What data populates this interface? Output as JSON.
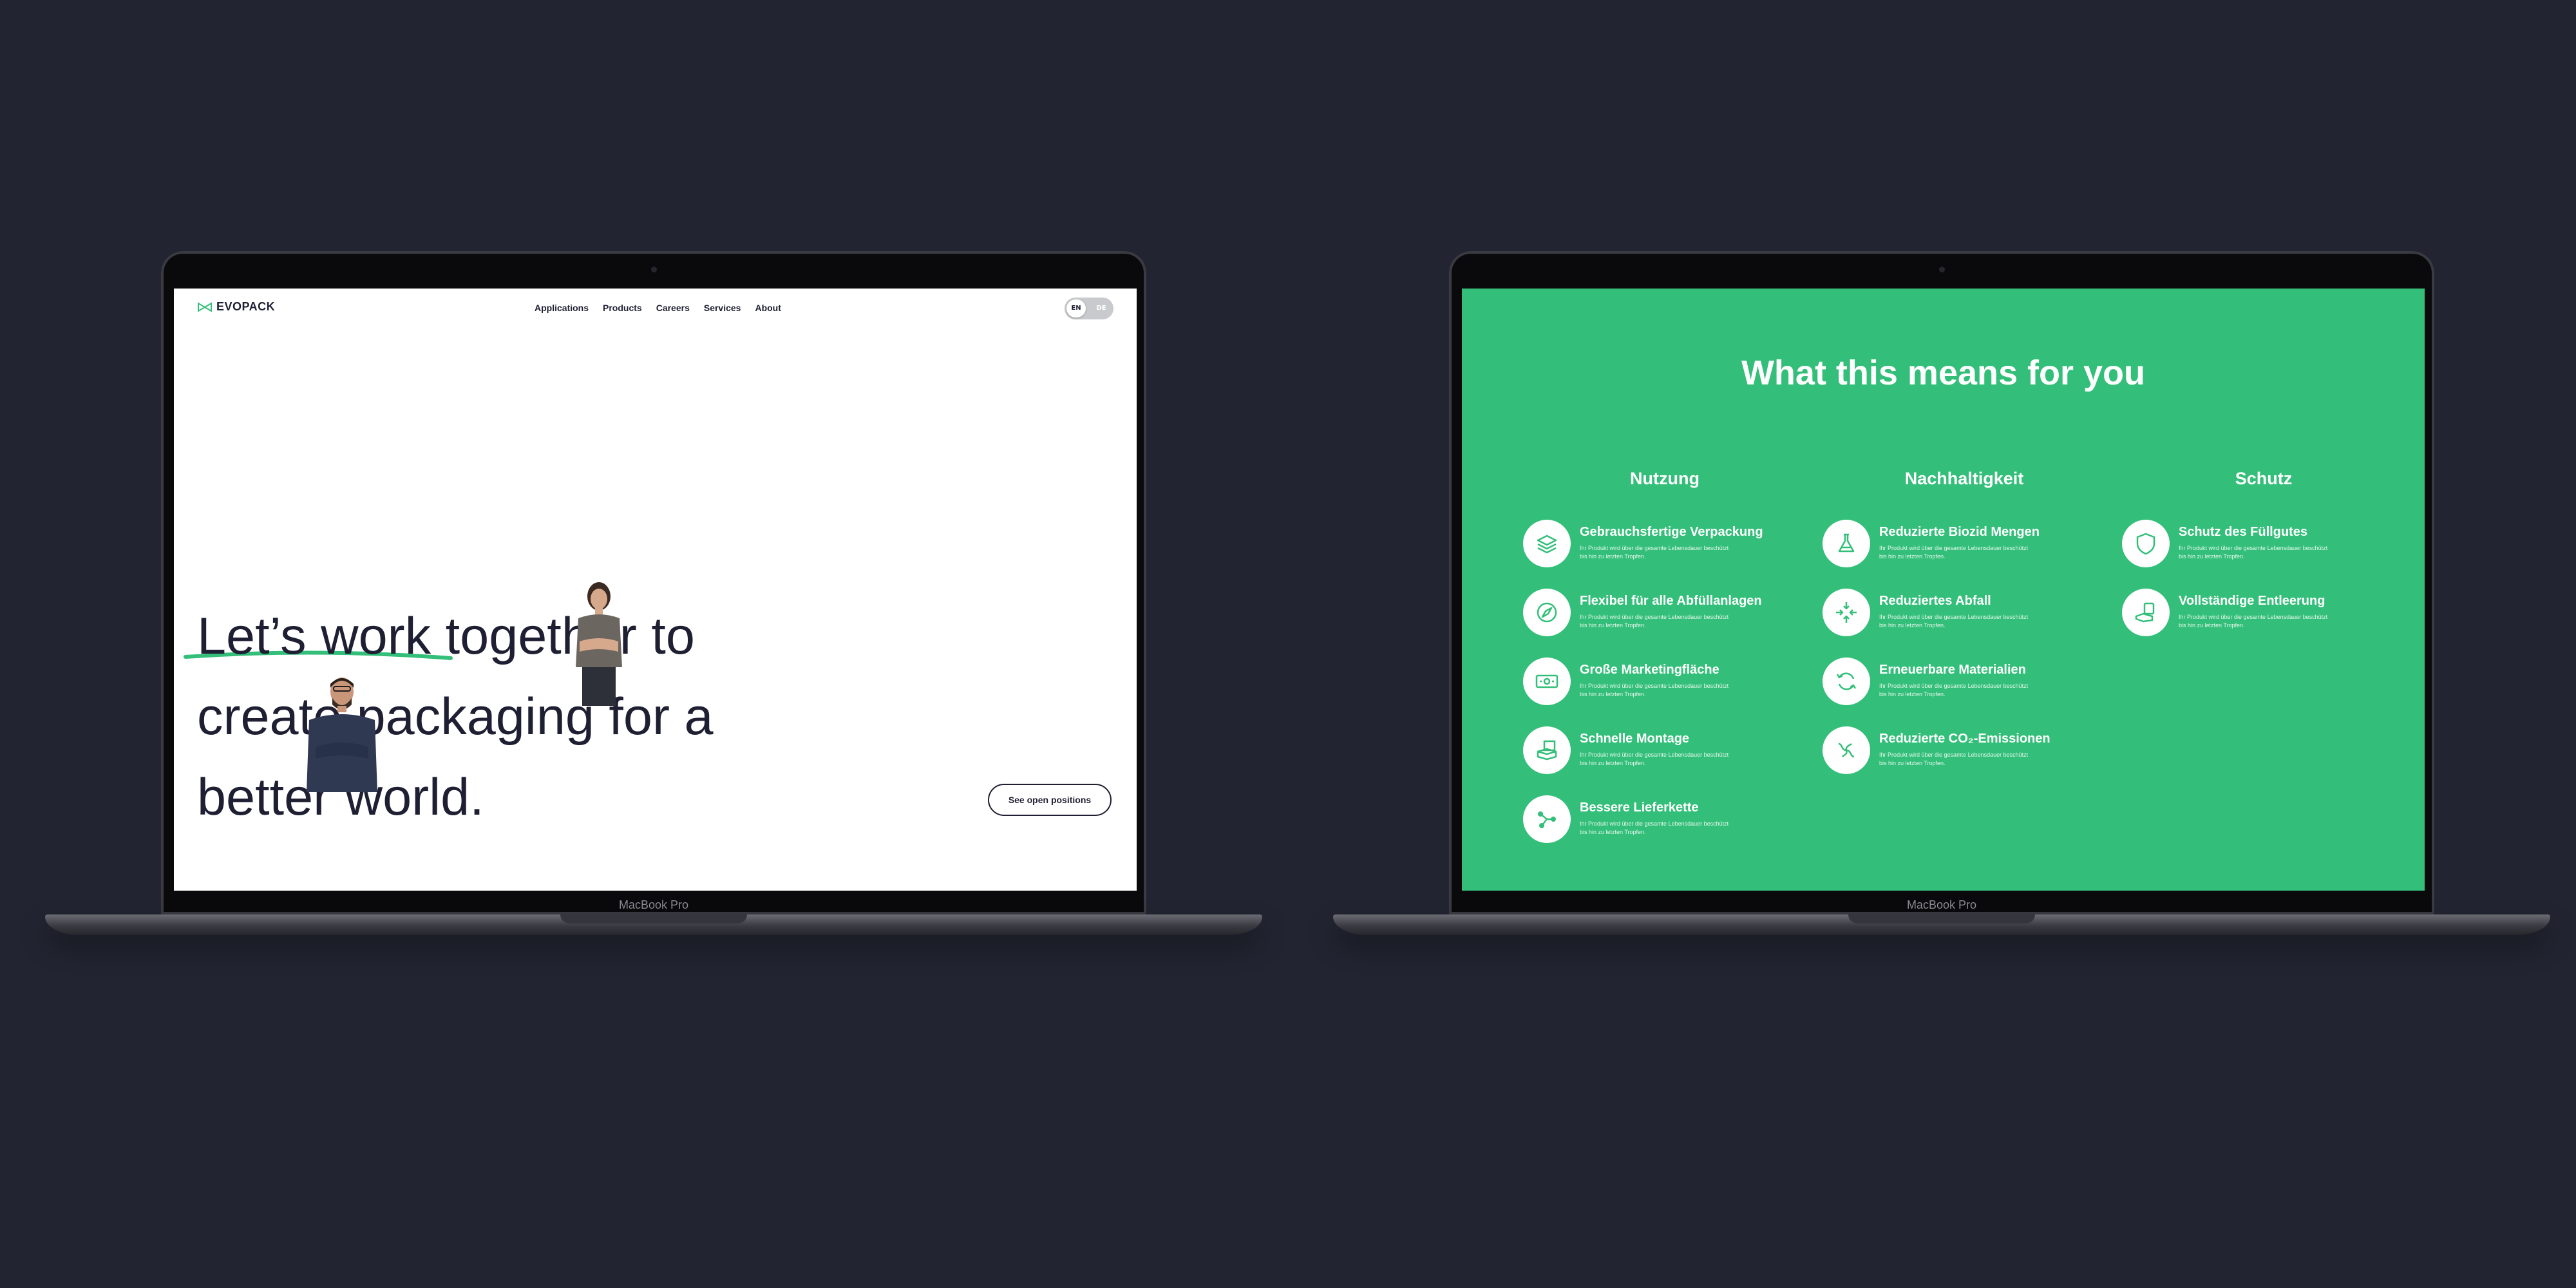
{
  "laptops": {
    "model_label": "MacBook Pro"
  },
  "left_screen": {
    "brand": "EVOPACK",
    "nav": [
      "Applications",
      "Products",
      "Careers",
      "Services",
      "About"
    ],
    "lang": {
      "active": "EN",
      "inactive": "DE"
    },
    "headline": [
      "Let’s work together to",
      "create packaging for a",
      "better world."
    ],
    "cta_label": "See open positions",
    "colors": {
      "accent": "#33bf79",
      "ink": "#1f1f33"
    }
  },
  "right_screen": {
    "title": "What this means for you",
    "colors": {
      "background": "#33bf79"
    },
    "columns": [
      {
        "heading": "Nutzung",
        "items": [
          {
            "title": "Gebrauchsfertige Verpackung",
            "icon": "layers-icon",
            "desc": "Ihr Produkt wird über die gesamte Lebensdauer beschützt bis hin zu letzten Tropfen."
          },
          {
            "title": "Flexibel für alle Abfüllanlagen",
            "icon": "compass-icon",
            "desc": "Ihr Produkt wird über die gesamte Lebensdauer beschützt bis hin zu letzten Tropfen."
          },
          {
            "title": "Große Marketingfläche",
            "icon": "banknote-icon",
            "desc": "Ihr Produkt wird über die gesamte Lebensdauer beschützt bis hin zu letzten Tropfen."
          },
          {
            "title": "Schnelle Montage",
            "icon": "box-stack-icon",
            "desc": "Ihr Produkt wird über die gesamte Lebensdauer beschützt bis hin zu letzten Tropfen."
          },
          {
            "title": "Bessere Lieferkette",
            "icon": "network-icon",
            "desc": "Ihr Produkt wird über die gesamte Lebensdauer beschützt bis hin zu letzten Tropfen."
          }
        ]
      },
      {
        "heading": "Nachhaltigkeit",
        "items": [
          {
            "title": "Reduzierte Biozid Mengen",
            "icon": "flask-icon",
            "desc": "Ihr Produkt wird über die gesamte Lebensdauer beschützt bis hin zu letzten Tropfen."
          },
          {
            "title": "Reduziertes Abfall",
            "icon": "shrink-arrows-icon",
            "desc": "Ihr Produkt wird über die gesamte Lebensdauer beschützt bis hin zu letzten Tropfen."
          },
          {
            "title": "Erneuerbare Materialien",
            "icon": "recycle-icon",
            "desc": "Ihr Produkt wird über die gesamte Lebensdauer beschützt bis hin zu letzten Tropfen."
          },
          {
            "title": "Reduzierte CO₂-Emissionen",
            "icon": "co2-icon",
            "desc": "Ihr Produkt wird über die gesamte Lebensdauer beschützt bis hin zu letzten Tropfen."
          }
        ]
      },
      {
        "heading": "Schutz",
        "items": [
          {
            "title": "Schutz des Füllgutes",
            "icon": "shield-icon",
            "desc": "Ihr Produkt wird über die gesamte Lebensdauer beschützt bis hin zu letzten Tropfen."
          },
          {
            "title": "Vollständige Entleerung",
            "icon": "empty-container-icon",
            "desc": "Ihr Produkt wird über die gesamte Lebensdauer beschützt bis hin zu letzten Tropfen."
          }
        ]
      }
    ]
  }
}
